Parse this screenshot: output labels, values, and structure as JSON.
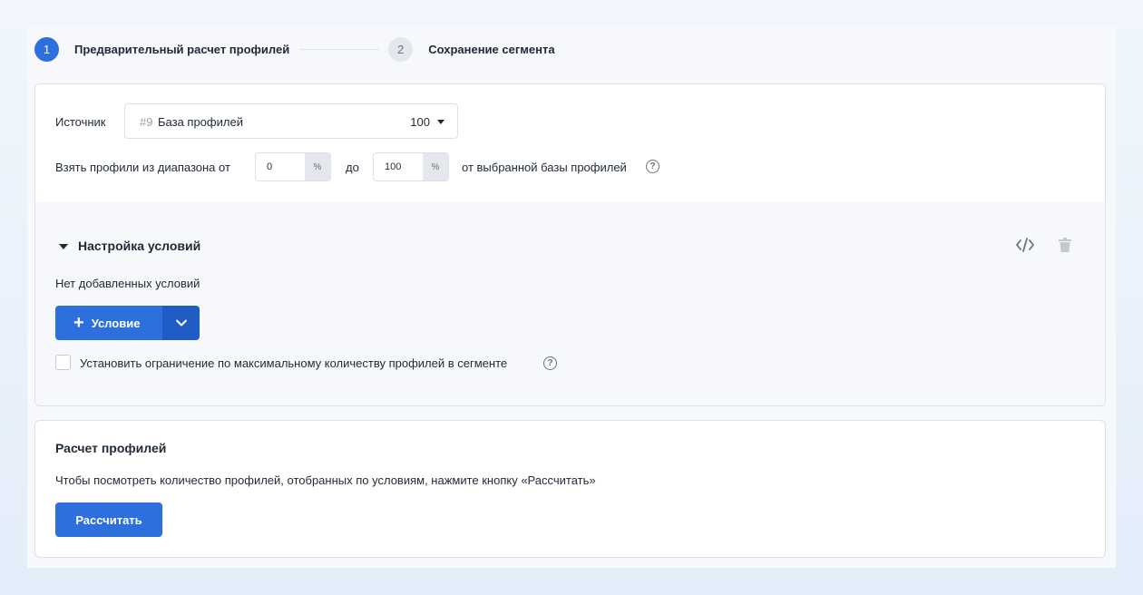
{
  "stepper": {
    "steps": [
      {
        "number": "1",
        "label": "Предварительный расчет профилей"
      },
      {
        "number": "2",
        "label": "Сохранение сегмента"
      }
    ]
  },
  "source": {
    "label": "Источник",
    "selected_id": "#9",
    "selected_name": "База профилей",
    "selected_count": "100",
    "range_label": "Взять профили из диапазона от",
    "from_value": "0",
    "unit": "%",
    "to_label": "до",
    "to_value": "100",
    "suffix": "от выбранной базы профилей"
  },
  "conditions": {
    "title": "Настройка условий",
    "empty_text": "Нет добавленных условий",
    "add_button": "Условие",
    "limit_checkbox_label": "Установить ограничение по максимальному количеству профилей в сегменте",
    "limit_checked": false
  },
  "calculation": {
    "title": "Расчет профилей",
    "description": "Чтобы посмотреть количество профилей, отобранных по условиям, нажмите кнопку «Рассчитать»",
    "button": "Рассчитать"
  },
  "colors": {
    "accent": "#2d6fdc",
    "accent_dark": "#1f5dc5",
    "background": "#f6f8fb"
  },
  "icons": [
    "chevron-down-icon",
    "code-icon",
    "trash-icon",
    "help-icon",
    "plus-icon"
  ]
}
